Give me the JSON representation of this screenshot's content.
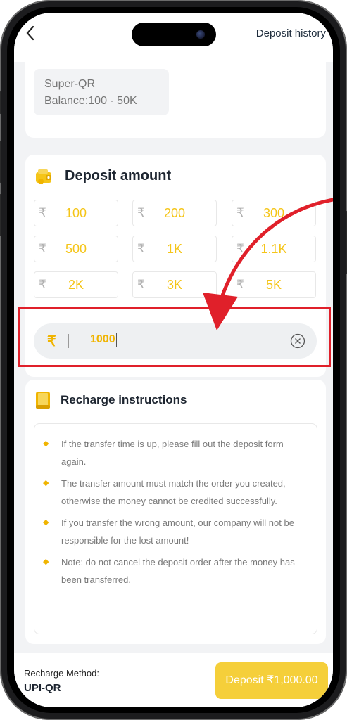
{
  "header": {
    "back_icon": "chevron-left-icon",
    "history_label": "Deposit history"
  },
  "channel": {
    "name": "Super-QR",
    "balance": "Balance:100 - 50K"
  },
  "deposit_amount": {
    "title": "Deposit amount",
    "icon": "wallet-icon",
    "currency_symbol": "₹",
    "presets": [
      "100",
      "200",
      "300",
      "500",
      "1K",
      "1.1K",
      "2K",
      "3K",
      "5K"
    ],
    "input_value": "1000",
    "input_currency": "₹"
  },
  "instructions": {
    "title": "Recharge instructions",
    "icon": "book-icon",
    "items": [
      "If the transfer time is up, please fill out the deposit form again.",
      "The transfer amount must match the order you created, otherwise the money cannot be credited successfully.",
      "If you transfer the wrong amount, our company will not be responsible for the lost amount!",
      "Note: do not cancel the deposit order after the money has been transferred."
    ]
  },
  "footer": {
    "method_label": "Recharge Method:",
    "method_value": "UPI-QR",
    "deposit_button": "Deposit ₹1,000.00"
  },
  "colors": {
    "accent": "#f5c518",
    "highlight": "#e0202a",
    "button": "#f5cf3a"
  }
}
